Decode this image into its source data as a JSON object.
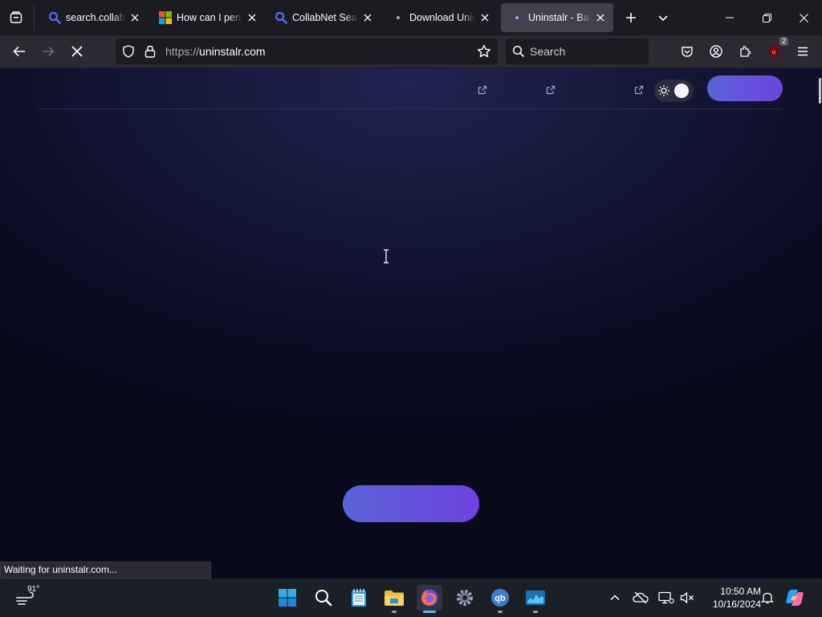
{
  "tabs": [
    {
      "title": "search.collabnet",
      "icon": "search-icon",
      "active": false
    },
    {
      "title": "How can I perma",
      "icon": "microsoft-logo-icon",
      "active": false
    },
    {
      "title": "CollabNet SearX",
      "icon": "search-icon",
      "active": false
    },
    {
      "title": "Download Unins",
      "icon": "loading-dot-icon",
      "active": false
    },
    {
      "title": "Uninstalr - Batch",
      "icon": "loading-dot-icon",
      "active": true
    }
  ],
  "navbar": {
    "url_protocol": "https://",
    "url_host": "uninstalr.com",
    "search_placeholder": "Search",
    "extension_badge": "2"
  },
  "status_bar": {
    "text": "Waiting for uninstalr.com..."
  },
  "taskbar": {
    "weather_temp": "91°",
    "clock_time": "10:50 AM",
    "clock_date": "10/16/2024"
  },
  "colors": {
    "accent_gradient_start": "#5a64d6",
    "accent_gradient_end": "#6e42e0",
    "page_background": "#0a0c22"
  }
}
